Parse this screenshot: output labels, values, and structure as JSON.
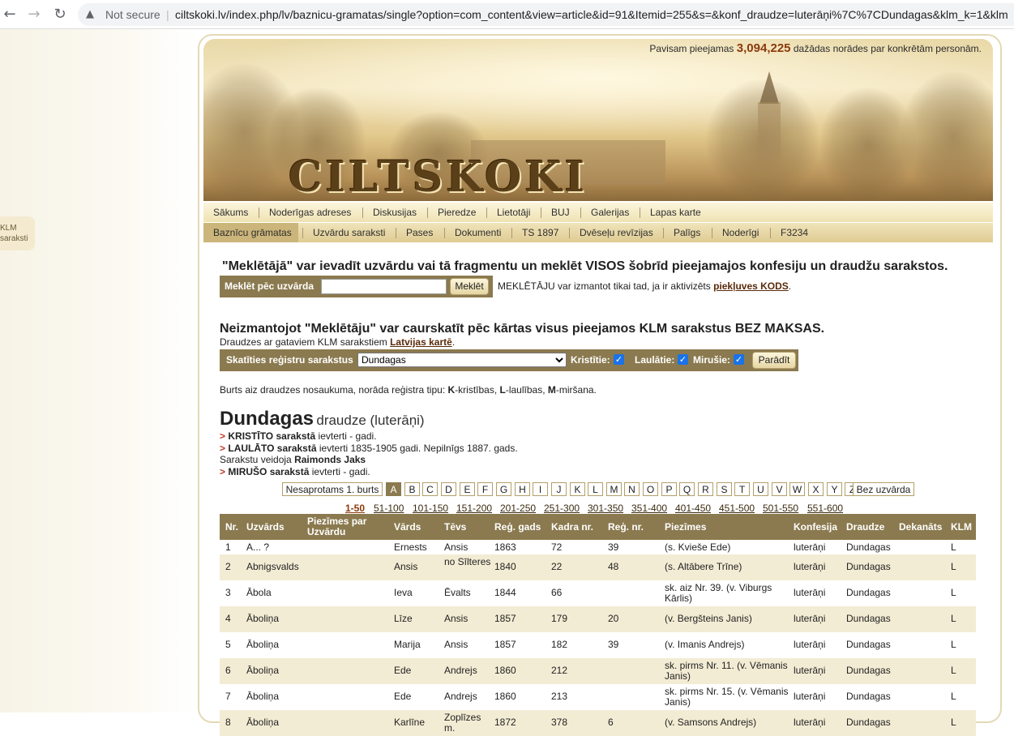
{
  "browser": {
    "warning": "Not secure",
    "url": "ciltskoki.lv/index.php/lv/baznicu-gramatas/single?option=com_content&view=article&id=91&Itemid=255&s=&konf_draudze=luterāņi%7C%7CDundagas&klm_k=1&klm"
  },
  "side_tab": {
    "line1": "KLM",
    "line2": "saraksti"
  },
  "header": {
    "count_prefix": "Pavisam pieejamas",
    "count_value": "3,094,225",
    "count_suffix": "dažādas norādes par konkrētām personām.",
    "logo": "CILTSKOKI"
  },
  "menu1": [
    "Sākums",
    "Noderīgas adreses",
    "Diskusijas",
    "Pieredze",
    "Lietotāji",
    "BUJ",
    "Galerijas",
    "Lapas karte"
  ],
  "menu2": [
    "Baznīcu grāmatas",
    "Uzvārdu saraksti",
    "Pases",
    "Dokumenti",
    "TS 1897",
    "Dvēseļu revīzijas",
    "Palīgs",
    "Noderīgi",
    "F3234"
  ],
  "search": {
    "heading": "\"Meklētājā\" var ievadīt uzvārdu vai tā fragmentu un meklēt VISOS šobrīd pieejamajos konfesiju un draudžu sarakstos.",
    "label": "Meklēt pēc uzvārda",
    "value": "",
    "button": "Meklēt",
    "note_text": "MEKLĒTĀJU var izmantot tikai tad, ja ir aktivizēts",
    "note_link": "piekļuves KODS",
    "note_end": "."
  },
  "browse": {
    "heading": "Neizmantojot \"Meklētāju\" var caurskatīt pēc kārtas visus pieejamos KLM sarakstus BEZ MAKSAS.",
    "sub_text": "Draudzes ar gataviem KLM sarakstiem",
    "sub_link": "Latvijas kartē",
    "sub_end": ".",
    "label": "Skatīties reģistru sarakstus",
    "selected": "Dundagas",
    "kristities": "Kristītie:",
    "laulatie": "Laulātie:",
    "mirusie": "Mirušie:",
    "button": "Parādīt",
    "check": "✓"
  },
  "legend": {
    "t1": "Burts aiz draudzes nosaukuma, norāda reģistra tipu: ",
    "k": "K",
    "t2": "-kristības, ",
    "l": "L",
    "t3": "-laulības, ",
    "m": "M",
    "t4": "-miršana."
  },
  "parish": {
    "name": "Dundagas",
    "suffix": "draudze (luterāņi)",
    "arrow": ">",
    "kristito_b": "KRISTĪTO sarakstā",
    "kristito_t": " ievterti - gadi.",
    "laulato_b": "LAULĀTO sarakstā",
    "laulato_t": " ievterti 1835-1905 gadi. Nepilnīgs 1887. gads.",
    "compiled_t": "Sarakstu veidoja ",
    "compiled_b": "Raimonds Jaks",
    "miruso_b": "MIRUŠO sarakstā",
    "miruso_t": " ievterti - gadi."
  },
  "letters": {
    "first": "Nesaprotams 1. burts",
    "list": [
      "A",
      "B",
      "C",
      "D",
      "E",
      "F",
      "G",
      "H",
      "I",
      "J",
      "K",
      "L",
      "M",
      "N",
      "O",
      "P",
      "Q",
      "R",
      "S",
      "T",
      "U",
      "V",
      "W",
      "X",
      "Y",
      "Z"
    ],
    "active": "A",
    "last": "Bez uzvārda"
  },
  "pages": [
    "1-50",
    "51-100",
    "101-150",
    "151-200",
    "201-250",
    "251-300",
    "301-350",
    "351-400",
    "401-450",
    "451-500",
    "501-550",
    "551-600"
  ],
  "table": {
    "headers": [
      "Nr.",
      "Uzvārds",
      "Piezīmes par Uzvārdu",
      "Vārds",
      "Tēvs",
      "Reģ. gads",
      "Kadra nr.",
      "Reģ. nr.",
      "Piezīmes",
      "Konfesija",
      "Draudze",
      "Dekanāts",
      "KLM"
    ],
    "rows": [
      [
        "1",
        "A... ?",
        "",
        "Ernests",
        "Ansis",
        "1863",
        "72",
        "39",
        "(s. Kvieše Ede)",
        "luterāņi",
        "Dundagas",
        "",
        "L"
      ],
      [
        "2",
        "Abnigsvalds",
        "",
        "Ansis",
        "no Sīlteres",
        "1840",
        "22",
        "48",
        "(s. Altābere Trīne)",
        "luterāņi",
        "Dundagas",
        "",
        "L"
      ],
      [
        "3",
        "Ābola",
        "",
        "Ieva",
        "Ēvalts",
        "1844",
        "66",
        "",
        "sk. aiz Nr. 39. (v. Viburgs Kārlis)",
        "luterāņi",
        "Dundagas",
        "",
        "L"
      ],
      [
        "4",
        "Āboliņa",
        "",
        "Līze",
        "Ansis",
        "1857",
        "179",
        "20",
        "(v. Bergšteins Janis)",
        "luterāņi",
        "Dundagas",
        "",
        "L"
      ],
      [
        "5",
        "Āboliņa",
        "",
        "Marija",
        "Ansis",
        "1857",
        "182",
        "39",
        "(v. Imanis Andrejs)",
        "luterāņi",
        "Dundagas",
        "",
        "L"
      ],
      [
        "6",
        "Āboliņa",
        "",
        "Ede",
        "Andrejs",
        "1860",
        "212",
        "",
        "sk. pirms Nr. 11. (v. Vēmanis Janis)",
        "luterāņi",
        "Dundagas",
        "",
        "L"
      ],
      [
        "7",
        "Āboliņa",
        "",
        "Ede",
        "Andrejs",
        "1860",
        "213",
        "",
        "sk. pirms Nr. 15. (v. Vēmanis Janis)",
        "luterāņi",
        "Dundagas",
        "",
        "L"
      ],
      [
        "8",
        "Āboliņa",
        "",
        "Karlīne",
        "Zoplīzes m.",
        "1872",
        "378",
        "6",
        "(v. Samsons Andrejs)",
        "luterāņi",
        "Dundagas",
        "",
        "L"
      ]
    ]
  }
}
